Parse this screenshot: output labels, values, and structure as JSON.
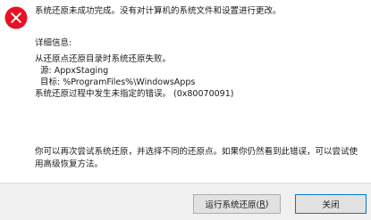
{
  "icon": {
    "name": "error-icon",
    "color": "#e81123"
  },
  "headline": "系统还原未成功完成。没有对计算机的系统文件和设置进行更改。",
  "details": {
    "heading": "详细信息:",
    "lines": [
      "从还原点还原目录时系统还原失败。",
      " 源: AppxStaging",
      " 目标: %ProgramFiles%\\WindowsApps",
      "系统还原过程中发生未指定的错误。 (0x80070091)"
    ]
  },
  "hint": "你可以再次尝试系统还原，并选择不同的还原点。如果你仍然看到此错误，可以尝试使用高级恢复方法。",
  "buttons": {
    "rerun": {
      "label_prefix": "运行系统还原(",
      "mnemonic": "R",
      "label_suffix": ")"
    },
    "close": "关闭"
  }
}
